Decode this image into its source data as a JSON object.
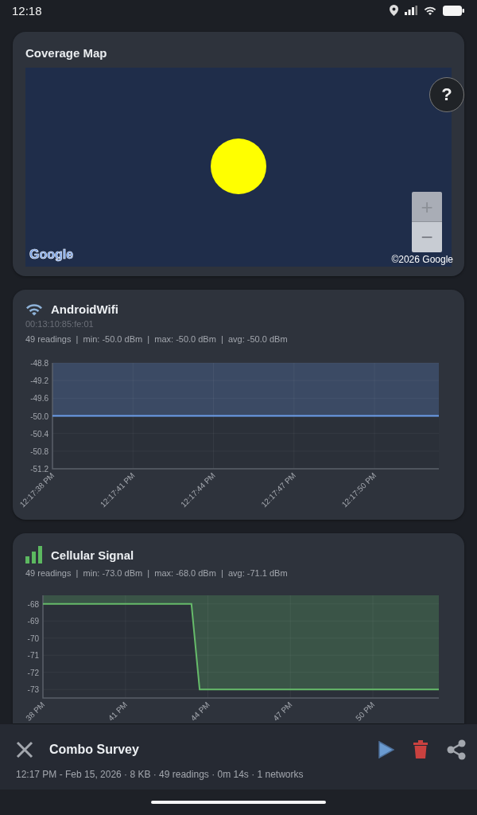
{
  "status_bar": {
    "time": "12:18"
  },
  "map_card": {
    "title": "Coverage Map",
    "help_button": "?",
    "zoom_in": "+",
    "zoom_out": "−",
    "logo": "Google",
    "attribution": "©2026 Google"
  },
  "networks": [
    {
      "kind": "wifi",
      "name": "AndroidWifi",
      "address": "00:13:10:85:fe:01",
      "stats": "49 readings  |  min: -50.0 dBm  |  max: -50.0 dBm  |  avg: -50.0 dBm",
      "chart_data": {
        "type": "area",
        "categories": [
          "12:17:38 PM",
          null,
          null,
          null,
          null,
          null,
          null,
          null,
          null,
          null,
          "12:17:41 PM",
          null,
          null,
          null,
          null,
          null,
          null,
          null,
          null,
          null,
          "12:17:44 PM",
          null,
          null,
          null,
          null,
          null,
          null,
          null,
          null,
          null,
          "12:17:47 PM",
          null,
          null,
          null,
          null,
          null,
          null,
          null,
          null,
          null,
          "12:17:50 PM",
          null,
          null,
          null,
          null,
          null,
          null,
          null,
          null
        ],
        "series": [
          {
            "color": "#6d9eeb",
            "values": [
              -50,
              -50,
              -50,
              -50,
              -50,
              -50,
              -50,
              -50,
              -50,
              -50,
              -50,
              -50,
              -50,
              -50,
              -50,
              -50,
              -50,
              -50,
              -50,
              -50,
              -50,
              -50,
              -50,
              -50,
              -50,
              -50,
              -50,
              -50,
              -50,
              -50,
              -50,
              -50,
              -50,
              -50,
              -50,
              -50,
              -50,
              -50,
              -50,
              -50,
              -50,
              -50,
              -50,
              -50,
              -50,
              -50,
              -50,
              -50,
              -50
            ]
          }
        ],
        "grid": true,
        "ylim": [
          -51.2,
          -48.8
        ],
        "yticks": [
          {
            "value": -48.8,
            "label": "-48.8"
          },
          {
            "value": -49.2,
            "label": "-49.2"
          },
          {
            "value": -49.6,
            "label": "-49.6"
          },
          {
            "value": -50,
            "label": "-50.0"
          },
          {
            "value": -50.4,
            "label": "-50.4"
          },
          {
            "value": -50.8,
            "label": "-50.8"
          },
          {
            "value": -51.2,
            "label": "-51.2"
          }
        ]
      }
    },
    {
      "kind": "cellular",
      "name": "Cellular Signal",
      "stats": "49 readings  |  min: -73.0 dBm  |  max: -68.0 dBm  |  avg: -71.1 dBm",
      "chart_data": {
        "type": "area",
        "categories": [
          "38 PM",
          null,
          null,
          null,
          null,
          null,
          null,
          null,
          null,
          null,
          "41 PM",
          null,
          null,
          null,
          null,
          null,
          null,
          null,
          null,
          null,
          "44 PM",
          null,
          null,
          null,
          null,
          null,
          null,
          null,
          null,
          null,
          "47 PM",
          null,
          null,
          null,
          null,
          null,
          null,
          null,
          null,
          null,
          "50 PM",
          null,
          null,
          null,
          null,
          null,
          null,
          null,
          null
        ],
        "series": [
          {
            "color": "#66bb6a",
            "values": [
              -68,
              -68,
              -68,
              -68,
              -68,
              -68,
              -68,
              -68,
              -68,
              -68,
              -68,
              -68,
              -68,
              -68,
              -68,
              -68,
              -68,
              -68,
              -68,
              -73,
              -73,
              -73,
              -73,
              -73,
              -73,
              -73,
              -73,
              -73,
              -73,
              -73,
              -73,
              -73,
              -73,
              -73,
              -73,
              -73,
              -73,
              -73,
              -73,
              -73,
              -73,
              -73,
              -73,
              -73,
              -73,
              -73,
              -73,
              -73,
              -73
            ]
          }
        ],
        "grid": true,
        "ylim": [
          -73.5,
          -67.5
        ],
        "yticks": [
          -68,
          -69,
          -70,
          -71,
          -72,
          -73
        ]
      }
    }
  ],
  "survey_bar": {
    "title": "Combo Survey",
    "details": "12:17 PM - Feb 15, 2026 · 8 KB · 49 readings · 0m 14s · 1 networks"
  }
}
